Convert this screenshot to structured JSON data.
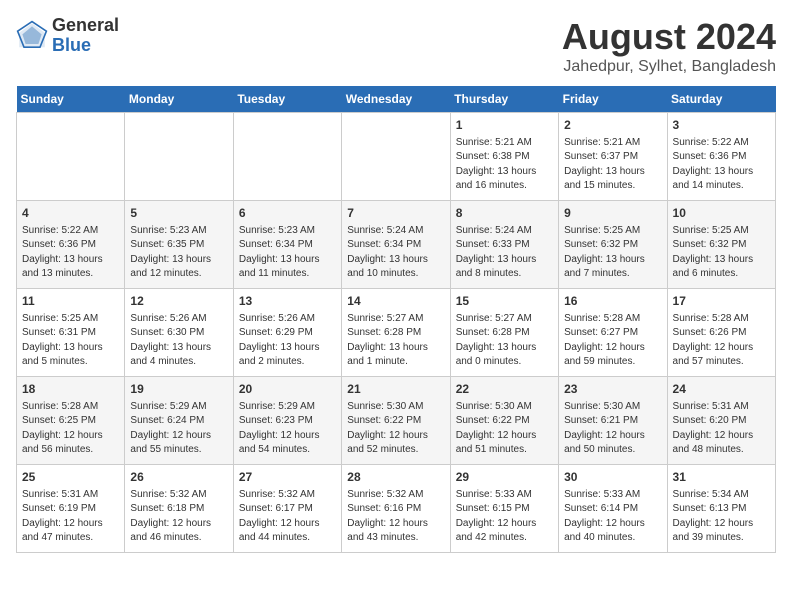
{
  "header": {
    "logo_line1": "General",
    "logo_line2": "Blue",
    "month_year": "August 2024",
    "location": "Jahedpur, Sylhet, Bangladesh"
  },
  "days_of_week": [
    "Sunday",
    "Monday",
    "Tuesday",
    "Wednesday",
    "Thursday",
    "Friday",
    "Saturday"
  ],
  "weeks": [
    [
      {
        "day": "",
        "info": ""
      },
      {
        "day": "",
        "info": ""
      },
      {
        "day": "",
        "info": ""
      },
      {
        "day": "",
        "info": ""
      },
      {
        "day": "1",
        "info": "Sunrise: 5:21 AM\nSunset: 6:38 PM\nDaylight: 13 hours\nand 16 minutes."
      },
      {
        "day": "2",
        "info": "Sunrise: 5:21 AM\nSunset: 6:37 PM\nDaylight: 13 hours\nand 15 minutes."
      },
      {
        "day": "3",
        "info": "Sunrise: 5:22 AM\nSunset: 6:36 PM\nDaylight: 13 hours\nand 14 minutes."
      }
    ],
    [
      {
        "day": "4",
        "info": "Sunrise: 5:22 AM\nSunset: 6:36 PM\nDaylight: 13 hours\nand 13 minutes."
      },
      {
        "day": "5",
        "info": "Sunrise: 5:23 AM\nSunset: 6:35 PM\nDaylight: 13 hours\nand 12 minutes."
      },
      {
        "day": "6",
        "info": "Sunrise: 5:23 AM\nSunset: 6:34 PM\nDaylight: 13 hours\nand 11 minutes."
      },
      {
        "day": "7",
        "info": "Sunrise: 5:24 AM\nSunset: 6:34 PM\nDaylight: 13 hours\nand 10 minutes."
      },
      {
        "day": "8",
        "info": "Sunrise: 5:24 AM\nSunset: 6:33 PM\nDaylight: 13 hours\nand 8 minutes."
      },
      {
        "day": "9",
        "info": "Sunrise: 5:25 AM\nSunset: 6:32 PM\nDaylight: 13 hours\nand 7 minutes."
      },
      {
        "day": "10",
        "info": "Sunrise: 5:25 AM\nSunset: 6:32 PM\nDaylight: 13 hours\nand 6 minutes."
      }
    ],
    [
      {
        "day": "11",
        "info": "Sunrise: 5:25 AM\nSunset: 6:31 PM\nDaylight: 13 hours\nand 5 minutes."
      },
      {
        "day": "12",
        "info": "Sunrise: 5:26 AM\nSunset: 6:30 PM\nDaylight: 13 hours\nand 4 minutes."
      },
      {
        "day": "13",
        "info": "Sunrise: 5:26 AM\nSunset: 6:29 PM\nDaylight: 13 hours\nand 2 minutes."
      },
      {
        "day": "14",
        "info": "Sunrise: 5:27 AM\nSunset: 6:28 PM\nDaylight: 13 hours\nand 1 minute."
      },
      {
        "day": "15",
        "info": "Sunrise: 5:27 AM\nSunset: 6:28 PM\nDaylight: 13 hours\nand 0 minutes."
      },
      {
        "day": "16",
        "info": "Sunrise: 5:28 AM\nSunset: 6:27 PM\nDaylight: 12 hours\nand 59 minutes."
      },
      {
        "day": "17",
        "info": "Sunrise: 5:28 AM\nSunset: 6:26 PM\nDaylight: 12 hours\nand 57 minutes."
      }
    ],
    [
      {
        "day": "18",
        "info": "Sunrise: 5:28 AM\nSunset: 6:25 PM\nDaylight: 12 hours\nand 56 minutes."
      },
      {
        "day": "19",
        "info": "Sunrise: 5:29 AM\nSunset: 6:24 PM\nDaylight: 12 hours\nand 55 minutes."
      },
      {
        "day": "20",
        "info": "Sunrise: 5:29 AM\nSunset: 6:23 PM\nDaylight: 12 hours\nand 54 minutes."
      },
      {
        "day": "21",
        "info": "Sunrise: 5:30 AM\nSunset: 6:22 PM\nDaylight: 12 hours\nand 52 minutes."
      },
      {
        "day": "22",
        "info": "Sunrise: 5:30 AM\nSunset: 6:22 PM\nDaylight: 12 hours\nand 51 minutes."
      },
      {
        "day": "23",
        "info": "Sunrise: 5:30 AM\nSunset: 6:21 PM\nDaylight: 12 hours\nand 50 minutes."
      },
      {
        "day": "24",
        "info": "Sunrise: 5:31 AM\nSunset: 6:20 PM\nDaylight: 12 hours\nand 48 minutes."
      }
    ],
    [
      {
        "day": "25",
        "info": "Sunrise: 5:31 AM\nSunset: 6:19 PM\nDaylight: 12 hours\nand 47 minutes."
      },
      {
        "day": "26",
        "info": "Sunrise: 5:32 AM\nSunset: 6:18 PM\nDaylight: 12 hours\nand 46 minutes."
      },
      {
        "day": "27",
        "info": "Sunrise: 5:32 AM\nSunset: 6:17 PM\nDaylight: 12 hours\nand 44 minutes."
      },
      {
        "day": "28",
        "info": "Sunrise: 5:32 AM\nSunset: 6:16 PM\nDaylight: 12 hours\nand 43 minutes."
      },
      {
        "day": "29",
        "info": "Sunrise: 5:33 AM\nSunset: 6:15 PM\nDaylight: 12 hours\nand 42 minutes."
      },
      {
        "day": "30",
        "info": "Sunrise: 5:33 AM\nSunset: 6:14 PM\nDaylight: 12 hours\nand 40 minutes."
      },
      {
        "day": "31",
        "info": "Sunrise: 5:34 AM\nSunset: 6:13 PM\nDaylight: 12 hours\nand 39 minutes."
      }
    ]
  ]
}
